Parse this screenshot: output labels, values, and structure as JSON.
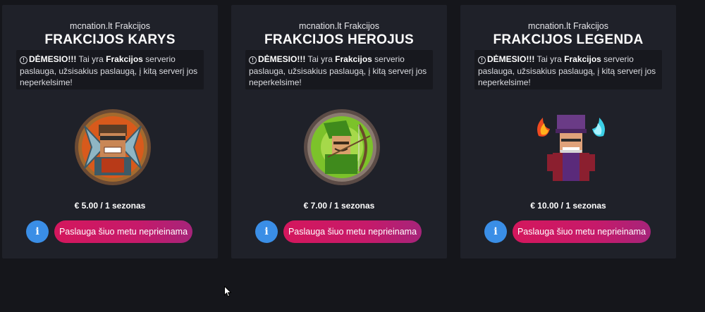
{
  "colors": {
    "background": "#15161b",
    "card": "#1f2129",
    "notice_bg": "#17181e",
    "info_button": "#3a8ee6",
    "buy_gradient_start": "#d4175d",
    "buy_gradient_end": "#a6247a"
  },
  "notice": {
    "icon": "exclamation-circle-icon",
    "label": "DĖMESIO!!!",
    "text_before": " Tai yra ",
    "highlight": "Frakcijos",
    "text_after": " serverio paslauga, užsisakius paslaugą, į kitą serverį jos neperkelsime!"
  },
  "info_label": "i",
  "cards": [
    {
      "server": "mcnation.lt Frakcijos",
      "title": "FRAKCIJOS KARYS",
      "price": "€ 5.00 / 1 sezonas",
      "button": "Paslauga šiuo metu neprieinama",
      "avatar_icon": "warrior-avatar-icon"
    },
    {
      "server": "mcnation.lt Frakcijos",
      "title": "FRAKCIJOS HEROJUS",
      "price": "€ 7.00 / 1 sezonas",
      "button": "Paslauga šiuo metu neprieinama",
      "avatar_icon": "archer-avatar-icon"
    },
    {
      "server": "mcnation.lt Frakcijos",
      "title": "FRAKCIJOS LEGENDA",
      "price": "€ 10.00 / 1 sezonas",
      "button": "Paslauga šiuo metu neprieinama",
      "avatar_icon": "wizard-avatar-icon"
    }
  ]
}
